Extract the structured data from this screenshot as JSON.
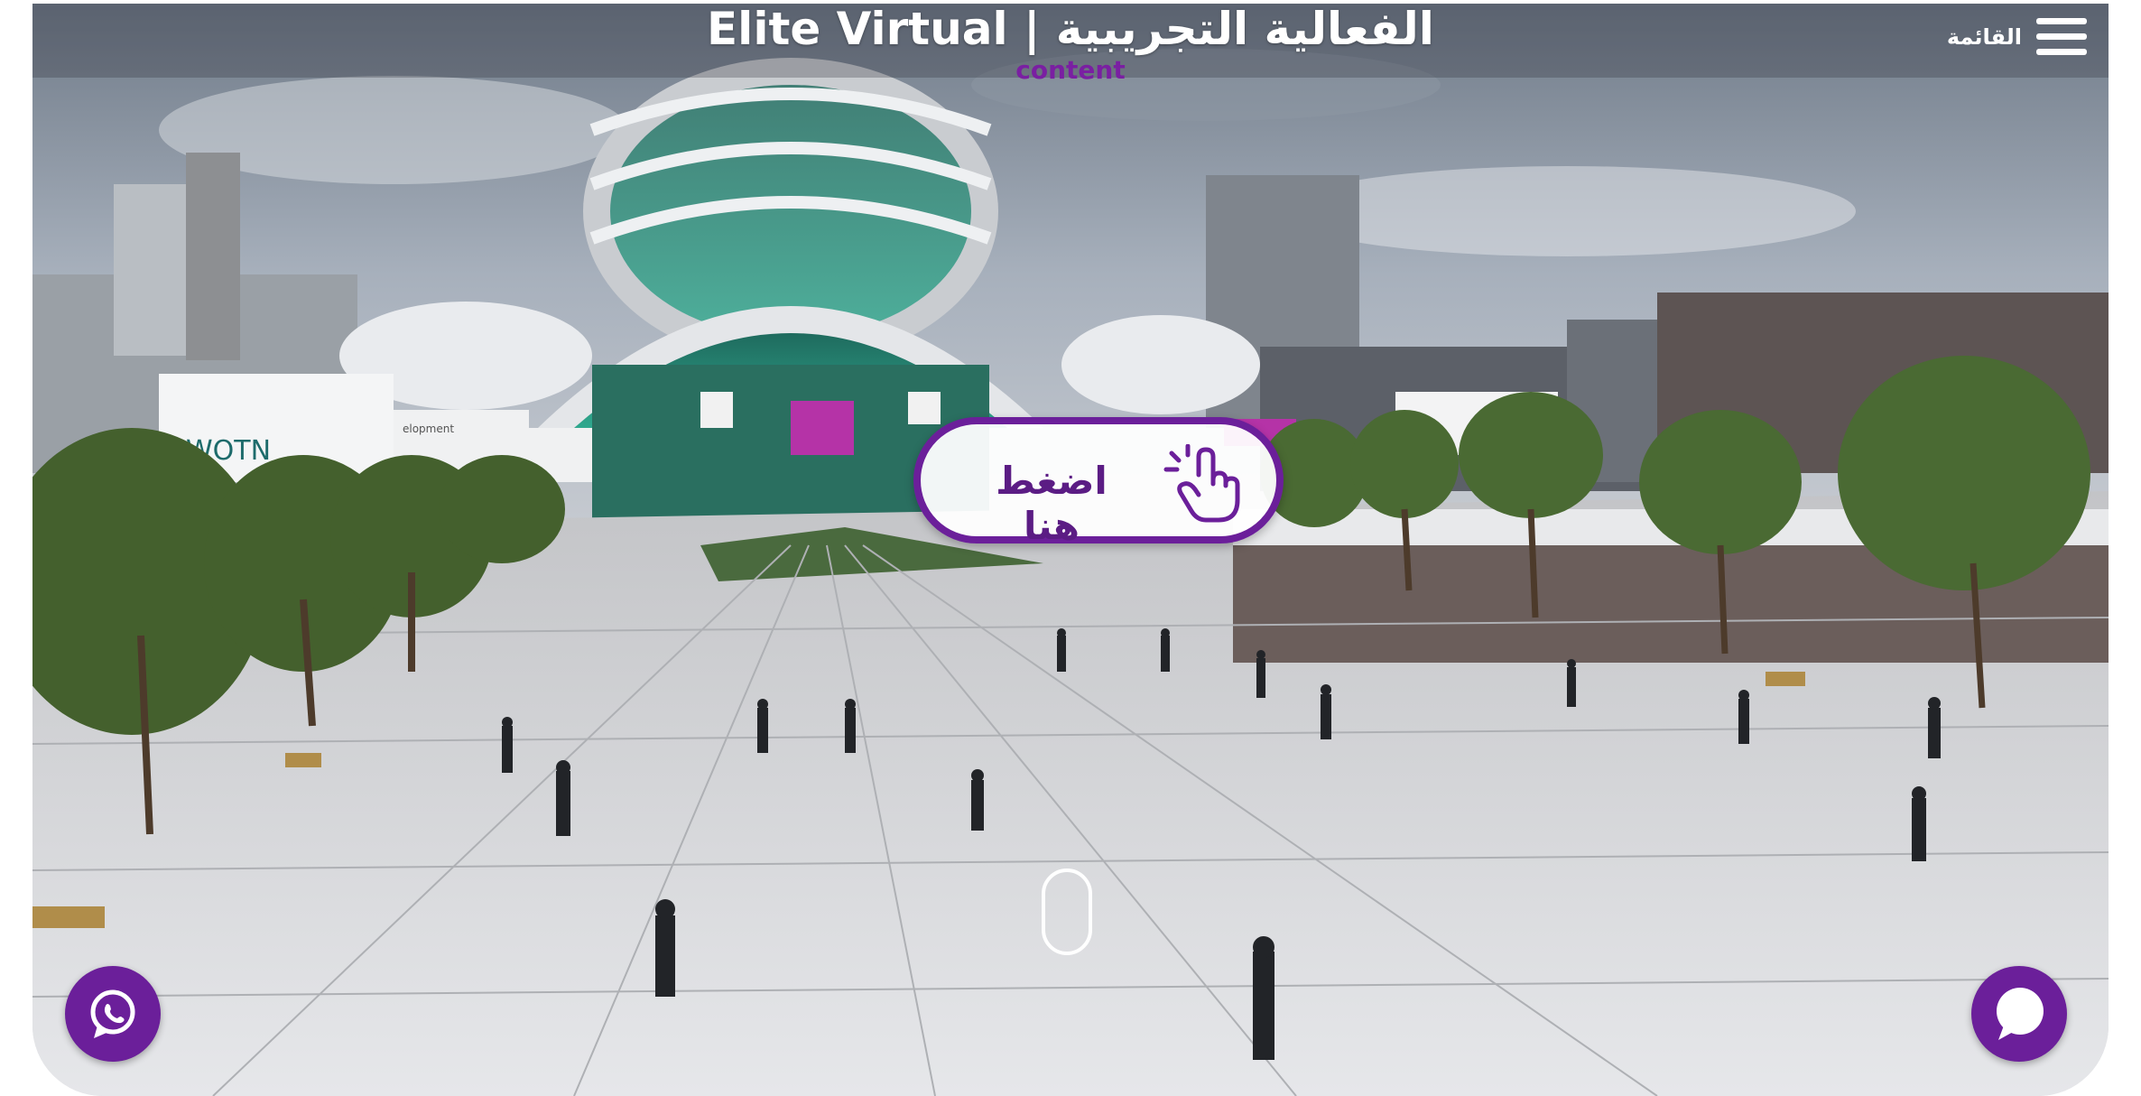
{
  "header": {
    "title": "Elite Virtual | الفعالية التجريبية",
    "subtitle": "content",
    "menu_label": "القائمة"
  },
  "scene": {
    "cta_label": "اضغط هنا",
    "accent_color": "#6b1f9a",
    "banner_text": "WOTN",
    "banner2_text": "elopment"
  },
  "icons": {
    "menu": "hamburger-icon",
    "cta": "tap-hand-icon",
    "whatsapp": "whatsapp-icon",
    "chat": "chat-bubble-icon",
    "scroll": "scroll-mouse-icon"
  }
}
